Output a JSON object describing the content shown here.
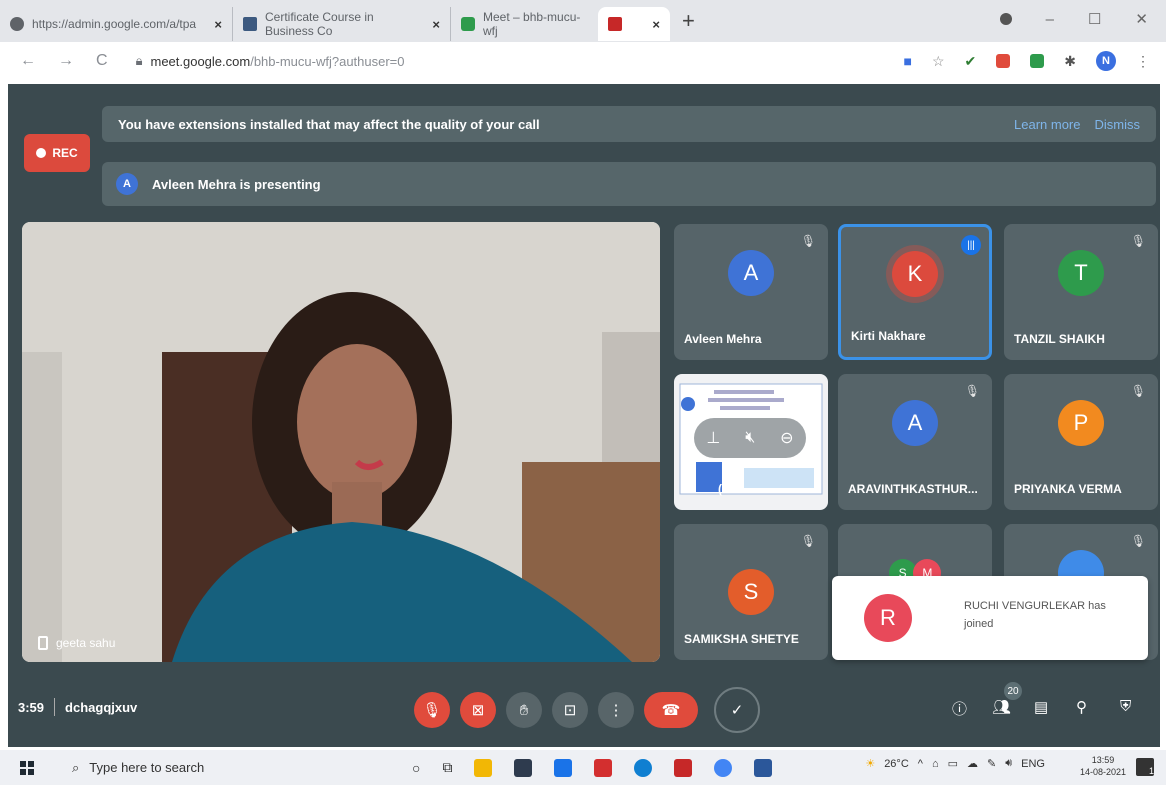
{
  "browser": {
    "tabs": [
      {
        "label": "https://admin.google.com/a/tpa",
        "close": "×"
      },
      {
        "label": "Certificate Course in Business Co",
        "close": "×"
      },
      {
        "label": "Meet – bhb-mucu-wfj",
        "close": ""
      },
      {
        "label": "",
        "close": "×"
      }
    ],
    "new_tab": "+",
    "url_host": "meet.google.com",
    "url_rest": "/bhb-mucu-wfj?authuser=0",
    "profile_initial": "N",
    "window_controls": [
      "–",
      "☐",
      "✕"
    ]
  },
  "meet": {
    "rec_label": "REC",
    "banner_text": "You have extensions installed that may affect the quality of your call",
    "banner_learn_more": "Learn more",
    "banner_dismiss": "Dismiss",
    "presenter_initial": "A",
    "presenting_text": "Avleen Mehra is presenting",
    "main_video_name": "geeta sahu",
    "participants": [
      {
        "initial": "A",
        "name": "Avleen Mehra",
        "color": "#3f73d6"
      },
      {
        "initial": "K",
        "name": "Kirti Nakhare",
        "color": "#dc4a3d"
      },
      {
        "initial": "T",
        "name": "TANZIL SHAIKH",
        "color": "#2e9b4c"
      },
      {
        "initial": "",
        "name": "(Av",
        "color": "#3f73d6"
      },
      {
        "initial": "A",
        "name": "ARAVINTHKASTHUR...",
        "color": "#3f73d6"
      },
      {
        "initial": "P",
        "name": "PRIYANKA VERMA",
        "color": "#f28a1f"
      },
      {
        "initial": "S",
        "name": "SAMIKSHA SHETYE",
        "color": "#e35d2b"
      },
      {
        "initial": "S",
        "name": "",
        "color": "#2e9b4c"
      },
      {
        "initial": "M",
        "name": "",
        "color": "#e8495a"
      },
      {
        "initial": "",
        "name": "",
        "color": "#3f8be8"
      }
    ],
    "toast": {
      "initial": "R",
      "text": "RUCHI VENGURLEKAR has joined"
    },
    "time": "3:59",
    "meeting_code": "dchagqjxuv",
    "participant_count": "20"
  },
  "taskbar": {
    "search_placeholder": "Type here to search",
    "weather": "26°C",
    "lang": "ENG",
    "time": "13:59",
    "date": "14-08-2021",
    "notifications": "1"
  },
  "colors": {
    "meet_bg": "#3b4a4f",
    "tile_bg": "#566469",
    "red": "#e04b3c",
    "active_border": "#3b92e8"
  }
}
